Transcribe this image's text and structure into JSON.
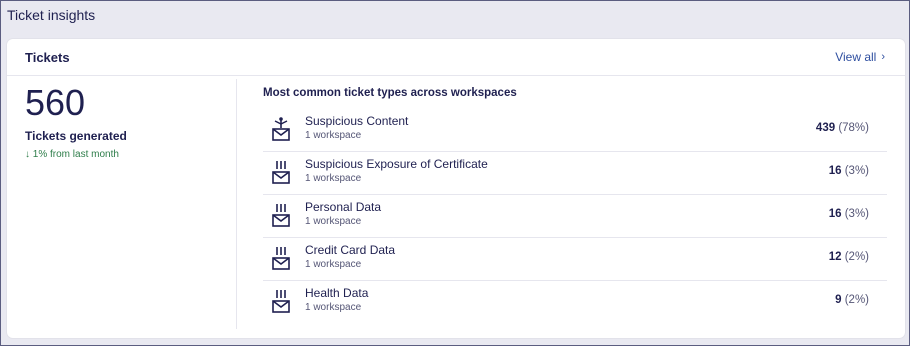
{
  "page": {
    "title": "Ticket insights"
  },
  "card": {
    "title": "Tickets",
    "view_all": "View all",
    "view_all_chevron": "›"
  },
  "summary": {
    "count": "560",
    "label": "Tickets generated",
    "trend": "↓ 1% from last month"
  },
  "ticket_types": {
    "title": "Most common ticket types across workspaces",
    "items": [
      {
        "name": "Suspicious Content",
        "workspaces": "1 workspace",
        "count": "439",
        "percent": "(78%)",
        "icon": "suspicious-content-icon"
      },
      {
        "name": "Suspicious Exposure of Certificate",
        "workspaces": "1 workspace",
        "count": "16",
        "percent": "(3%)",
        "icon": "data-leak-icon"
      },
      {
        "name": "Personal Data",
        "workspaces": "1 workspace",
        "count": "16",
        "percent": "(3%)",
        "icon": "data-leak-icon"
      },
      {
        "name": "Credit Card Data",
        "workspaces": "1 workspace",
        "count": "12",
        "percent": "(2%)",
        "icon": "data-leak-icon"
      },
      {
        "name": "Health Data",
        "workspaces": "1 workspace",
        "count": "9",
        "percent": "(2%)",
        "icon": "data-leak-icon"
      }
    ]
  },
  "colors": {
    "text_primary": "#1f2050",
    "link": "#2f4fa0",
    "trend_down": "#2e7d4a"
  }
}
